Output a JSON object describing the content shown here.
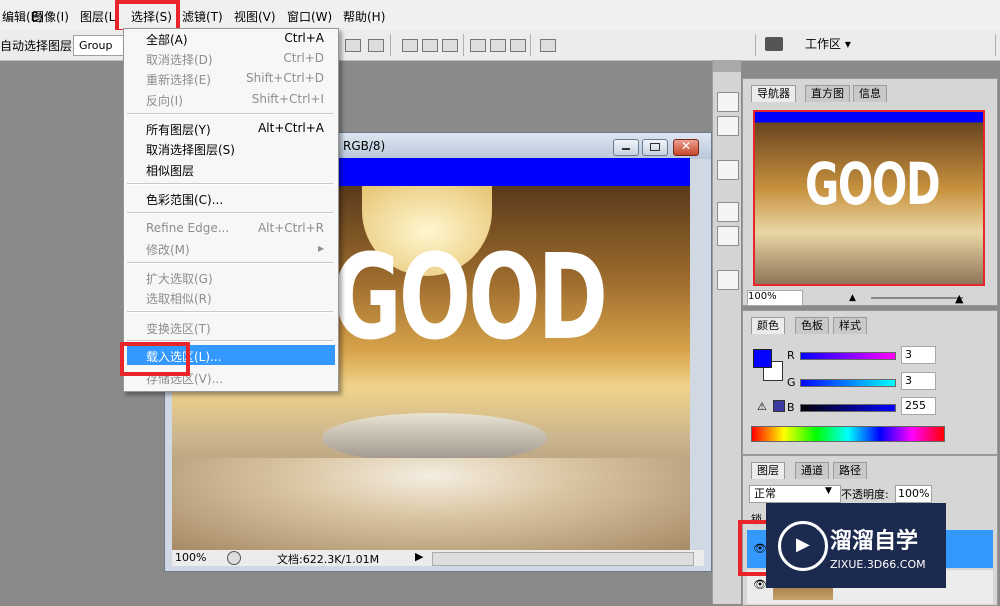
{
  "menubar": {
    "items": [
      "编辑(E)",
      "图像(I)",
      "图层(L)",
      "选择(S)",
      "滤镜(T)",
      "视图(V)",
      "窗口(W)",
      "帮助(H)"
    ]
  },
  "options": {
    "auto_select_label": "自动选择图层",
    "group_value": "Group",
    "workspace_label": "工作区 ▾"
  },
  "select_menu": {
    "items": [
      {
        "label": "全部(A)",
        "shortcut": "Ctrl+A",
        "disabled": false
      },
      {
        "label": "取消选择(D)",
        "shortcut": "Ctrl+D",
        "disabled": true
      },
      {
        "label": "重新选择(E)",
        "shortcut": "Shift+Ctrl+D",
        "disabled": true
      },
      {
        "label": "反向(I)",
        "shortcut": "Shift+Ctrl+I",
        "disabled": true
      },
      {
        "label": "所有图层(Y)",
        "shortcut": "Alt+Ctrl+A",
        "disabled": false
      },
      {
        "label": "取消选择图层(S)",
        "shortcut": "",
        "disabled": false
      },
      {
        "label": "相似图层",
        "shortcut": "",
        "disabled": false
      },
      {
        "label": "色彩范围(C)...",
        "shortcut": "",
        "disabled": false
      },
      {
        "label": "Refine Edge...",
        "shortcut": "Alt+Ctrl+R",
        "disabled": true
      },
      {
        "label": "修改(M)",
        "shortcut": "▸",
        "disabled": true
      },
      {
        "label": "扩大选取(G)",
        "shortcut": "",
        "disabled": true
      },
      {
        "label": "选取相似(R)",
        "shortcut": "",
        "disabled": true
      },
      {
        "label": "变换选区(T)",
        "shortcut": "",
        "disabled": true
      },
      {
        "label": "载入选区(L)...",
        "shortcut": "",
        "disabled": false,
        "highlighted": true
      },
      {
        "label": "存储选区(V)...",
        "shortcut": "",
        "disabled": true
      }
    ]
  },
  "document": {
    "title_suffix": "RGB/8)",
    "canvas_text": "GOOD",
    "zoom": "100%",
    "doc_info": "文档:622.3K/1.01M"
  },
  "navigator": {
    "tabs": [
      "导航器",
      "直方图",
      "信息"
    ],
    "zoom": "100%",
    "thumb_text": "GOOD"
  },
  "color_panel": {
    "tabs": [
      "颜色",
      "色板",
      "样式"
    ],
    "channels": [
      {
        "label": "R",
        "value": "3"
      },
      {
        "label": "G",
        "value": "3"
      },
      {
        "label": "B",
        "value": "255"
      }
    ],
    "foreground": "#0303ff"
  },
  "layers_panel": {
    "tabs": [
      "图层",
      "通道",
      "路径"
    ],
    "blend_mode": "正常",
    "opacity_label": "不透明度:",
    "opacity_value": "100%",
    "lock_label": "锁"
  },
  "watermark": {
    "title": "溜溜自学",
    "url": "ZIXUE.3D66.COM"
  },
  "colors": {
    "accent_red": "#e8252b",
    "menu_highlight": "#3399ff",
    "canvas_top_bar": "#0000ff"
  }
}
